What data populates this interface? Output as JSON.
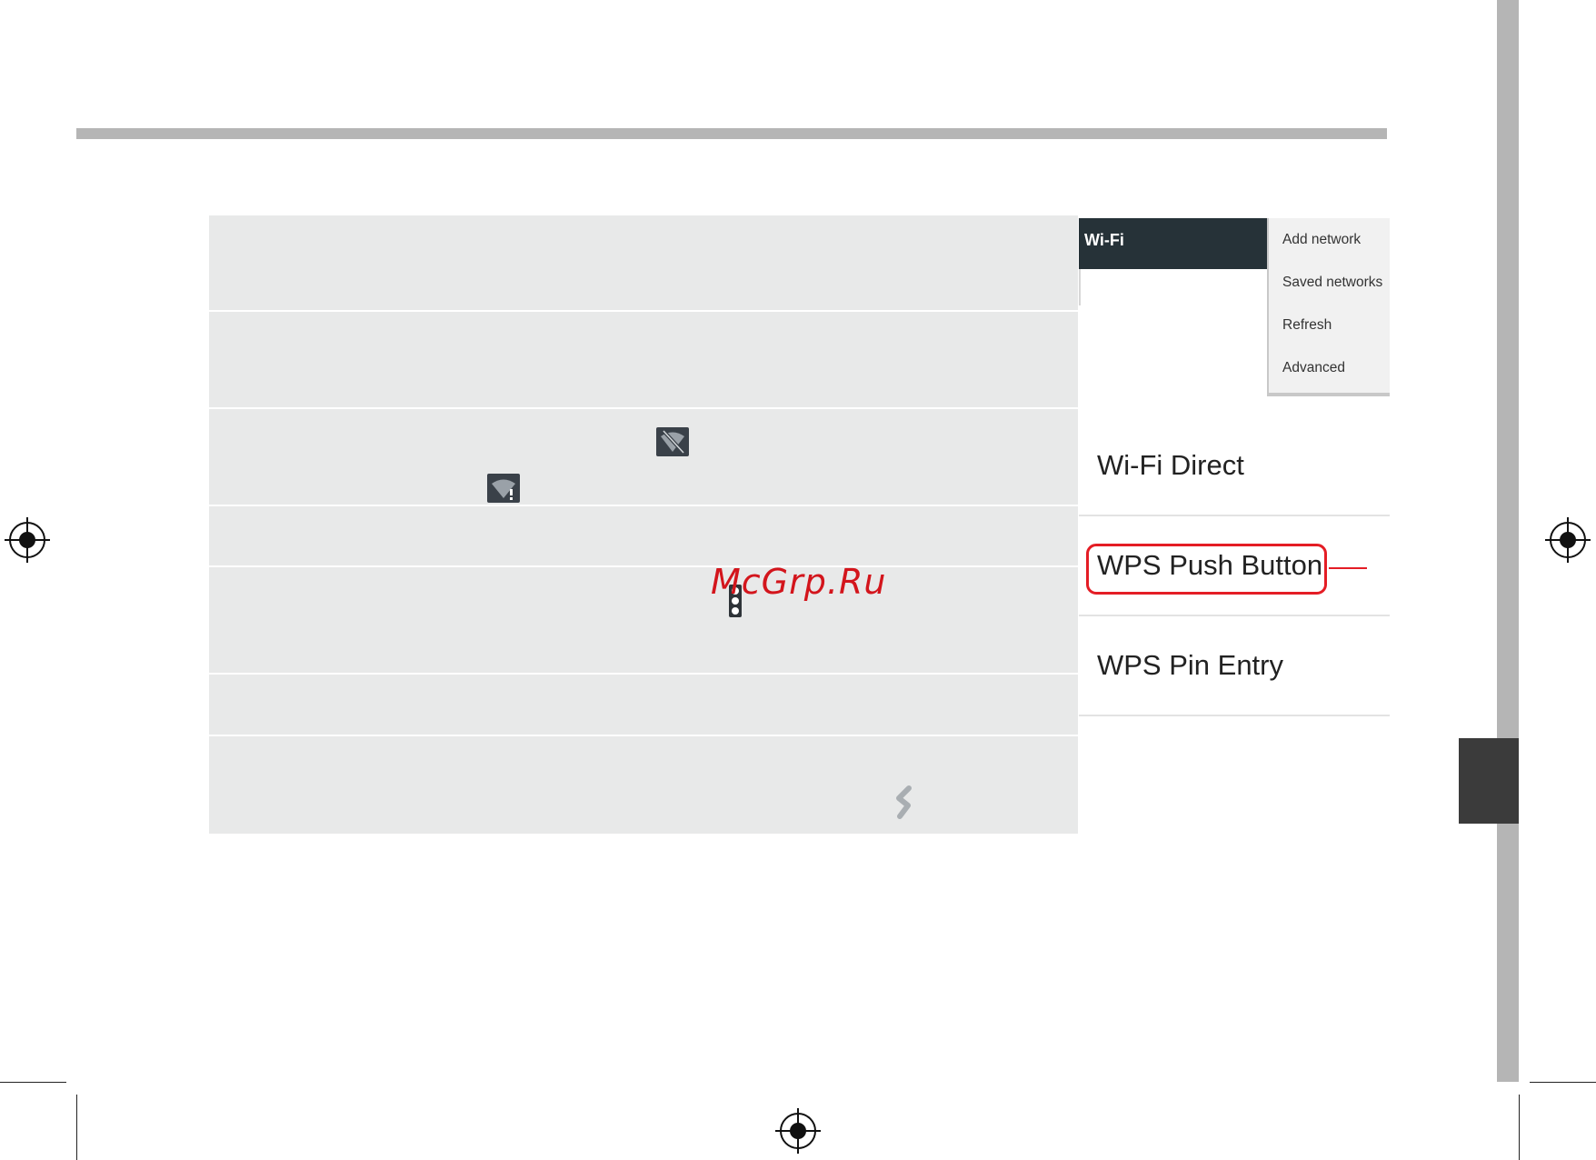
{
  "screenshot": {
    "appbar_title": "Wi-Fi",
    "menu_items": [
      "Add network",
      "Saved networks",
      "Refresh",
      "Advanced"
    ],
    "options": [
      "Wi-Fi Direct",
      "WPS Push Button",
      "WPS Pin Entry"
    ],
    "highlighted_option": "WPS Push Button"
  },
  "watermark": "McGrp.Ru",
  "colors": {
    "appbar": "#263238",
    "highlight": "#e41d25",
    "table_bg": "#e8e9e9",
    "header_rule": "#b5b5b5",
    "edge_tab": "#3b3b3b"
  },
  "icons": [
    "wifi-off-icon",
    "wifi-alert-icon",
    "overflow-menu-icon",
    "refresh-link-icon"
  ]
}
